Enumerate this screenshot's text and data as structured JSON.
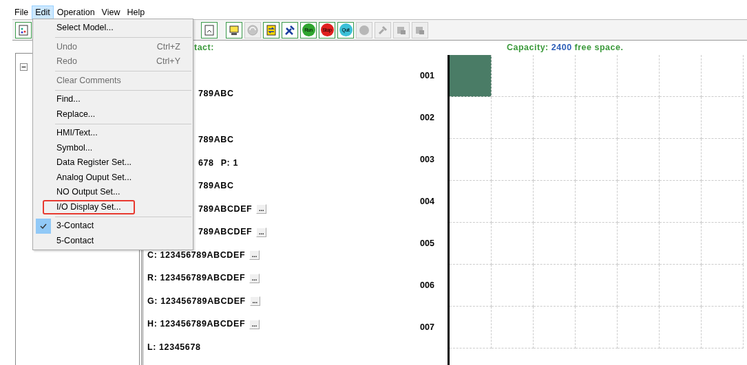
{
  "menubar": [
    {
      "label": "File",
      "selected": false
    },
    {
      "label": "Edit",
      "selected": true
    },
    {
      "label": "Operation",
      "selected": false
    },
    {
      "label": "View",
      "selected": false
    },
    {
      "label": "Help",
      "selected": false
    }
  ],
  "toolbar": [
    {
      "kind": "icon",
      "disabled": false
    },
    {
      "kind": "icon",
      "disabled": false
    },
    {
      "kind": "icon",
      "disabled": false
    },
    {
      "kind": "icon",
      "disabled": true
    },
    {
      "kind": "icon",
      "disabled": false
    },
    {
      "kind": "icon",
      "disabled": false
    },
    {
      "kind": "label",
      "label": "Run",
      "color": "#2fa52f",
      "disabled": false
    },
    {
      "kind": "label",
      "label": "Stop",
      "color": "#e02020",
      "disabled": false
    },
    {
      "kind": "label",
      "label": "Quit",
      "color": "#3cc0d8",
      "disabled": false
    },
    {
      "kind": "icon",
      "disabled": true
    },
    {
      "kind": "icon",
      "disabled": true
    },
    {
      "kind": "icon",
      "disabled": true
    },
    {
      "kind": "icon",
      "disabled": true
    }
  ],
  "tree": {
    "expanded": true
  },
  "header": {
    "contact_label": "tact:",
    "capacity_label": "Capacity:",
    "capacity_value": "2400",
    "capacity_suffix": "free space."
  },
  "info_lines": [
    {
      "kind": "covered",
      "text": "789ABC"
    },
    {
      "kind": "covered",
      "text": "789ABC"
    },
    {
      "kind": "covered",
      "text": "678",
      "extra": "P: 1"
    },
    {
      "kind": "covered",
      "text": "789ABC"
    },
    {
      "kind": "covered",
      "text": "789ABCDEF",
      "button": "..."
    },
    {
      "kind": "covered",
      "text": "789ABCDEF",
      "button": "..."
    },
    {
      "kind": "full",
      "text": "C: 123456789ABCDEF",
      "button": "..."
    },
    {
      "kind": "full",
      "text": "R: 123456789ABCDEF",
      "button": "..."
    },
    {
      "kind": "full",
      "text": "G: 123456789ABCDEF",
      "button": "..."
    },
    {
      "kind": "full",
      "text": "H: 123456789ABCDEF",
      "button": "..."
    },
    {
      "kind": "full",
      "text": "L: 12345678"
    }
  ],
  "grid": {
    "rows": [
      {
        "label": "001",
        "cells": [
          {
            "selected": true
          },
          {
            "selected": false
          },
          {
            "selected": false
          },
          {
            "selected": false
          },
          {
            "selected": false
          },
          {
            "selected": false
          },
          {
            "selected": false
          }
        ]
      },
      {
        "label": "002",
        "cells": [
          {
            "selected": false
          },
          {
            "selected": false
          },
          {
            "selected": false
          },
          {
            "selected": false
          },
          {
            "selected": false
          },
          {
            "selected": false
          },
          {
            "selected": false
          }
        ]
      },
      {
        "label": "003",
        "cells": [
          {
            "selected": false
          },
          {
            "selected": false
          },
          {
            "selected": false
          },
          {
            "selected": false
          },
          {
            "selected": false
          },
          {
            "selected": false
          },
          {
            "selected": false
          }
        ]
      },
      {
        "label": "004",
        "cells": [
          {
            "selected": false
          },
          {
            "selected": false
          },
          {
            "selected": false
          },
          {
            "selected": false
          },
          {
            "selected": false
          },
          {
            "selected": false
          },
          {
            "selected": false
          }
        ]
      },
      {
        "label": "005",
        "cells": [
          {
            "selected": false
          },
          {
            "selected": false
          },
          {
            "selected": false
          },
          {
            "selected": false
          },
          {
            "selected": false
          },
          {
            "selected": false
          },
          {
            "selected": false
          }
        ]
      },
      {
        "label": "006",
        "cells": [
          {
            "selected": false
          },
          {
            "selected": false
          },
          {
            "selected": false
          },
          {
            "selected": false
          },
          {
            "selected": false
          },
          {
            "selected": false
          },
          {
            "selected": false
          }
        ]
      },
      {
        "label": "007",
        "cells": [
          {
            "selected": false
          },
          {
            "selected": false
          },
          {
            "selected": false
          },
          {
            "selected": false
          },
          {
            "selected": false
          },
          {
            "selected": false
          },
          {
            "selected": false
          }
        ]
      }
    ]
  },
  "edit_menu": [
    {
      "kind": "item",
      "label": "Select Model...",
      "disabled": false
    },
    {
      "kind": "separator"
    },
    {
      "kind": "item",
      "label": "Undo",
      "shortcut": "Ctrl+Z",
      "disabled": true
    },
    {
      "kind": "item",
      "label": "Redo",
      "shortcut": "Ctrl+Y",
      "disabled": true
    },
    {
      "kind": "separator"
    },
    {
      "kind": "item",
      "label": "Clear Comments",
      "disabled": true
    },
    {
      "kind": "separator"
    },
    {
      "kind": "item",
      "label": "Find...",
      "disabled": false
    },
    {
      "kind": "item",
      "label": "Replace...",
      "disabled": false
    },
    {
      "kind": "separator"
    },
    {
      "kind": "item",
      "label": "HMI/Text...",
      "disabled": false
    },
    {
      "kind": "item",
      "label": "Symbol...",
      "disabled": false
    },
    {
      "kind": "item",
      "label": "Data Register Set...",
      "disabled": false
    },
    {
      "kind": "item",
      "label": "Analog Ouput Set...",
      "disabled": false
    },
    {
      "kind": "item",
      "label": "NO Output Set...",
      "disabled": false
    },
    {
      "kind": "item",
      "label": "I/O Display Set...",
      "disabled": false,
      "annotated": true
    },
    {
      "kind": "separator"
    },
    {
      "kind": "check",
      "label": "3-Contact",
      "checked": true
    },
    {
      "kind": "check",
      "label": "5-Contact",
      "checked": false
    }
  ]
}
